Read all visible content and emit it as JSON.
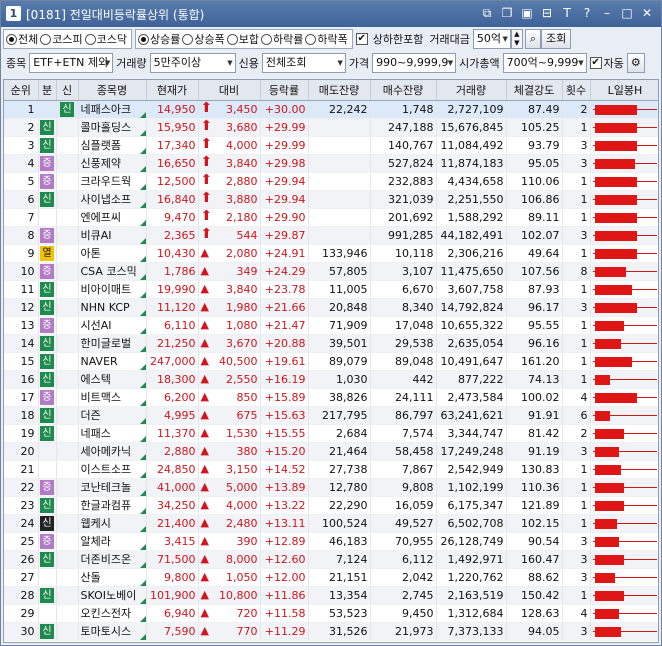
{
  "window": {
    "number": "1",
    "title": "[0181] 전일대비등락률상위 (통합)"
  },
  "filters": {
    "market_radios": [
      "전체",
      "코스피",
      "코스닥"
    ],
    "market_selected": 0,
    "sort_radios": [
      "상승률",
      "상승폭",
      "보합",
      "하락률",
      "하락폭"
    ],
    "sort_selected": 0,
    "include_limit_label": "상하한포함",
    "include_limit_checked": true,
    "volume_amount_label": "거래대금",
    "volume_amount_value": "50억",
    "search_button": "조회",
    "item_label": "종목",
    "item_value": "ETF+ETN 제외",
    "volume_label": "거래량",
    "volume_value": "5만주이상",
    "credit_label": "신용",
    "credit_value": "전체조회",
    "price_label": "가격",
    "price_value": "990~9,999,9",
    "mcap_label": "시가총액",
    "mcap_value": "700억~9,999",
    "auto_label": "자동",
    "auto_checked": true,
    "settings_icon": "gear-icon"
  },
  "columns": [
    "순위",
    "분",
    "신",
    "종목명",
    "현재가",
    "대비",
    "등락률",
    "매도잔량",
    "매수잔량",
    "거래량",
    "체결강도",
    "횟수",
    "L일봉H"
  ],
  "rows": [
    {
      "rank": "1",
      "badge": "",
      "badge_color": "",
      "new": "신",
      "name": "네패스아크",
      "price": "14,950",
      "arrow": "up",
      "diff": "3,450",
      "rate": "+30.00",
      "sell": "22,242",
      "buy": "1,748",
      "volume": "2,727,109",
      "strength": "87.49",
      "count": "2",
      "candle": 0.95
    },
    {
      "rank": "2",
      "badge": "신",
      "badge_color": "green",
      "new": "",
      "name": "콜마홀딩스",
      "price": "15,950",
      "arrow": "up",
      "diff": "3,680",
      "rate": "+29.99",
      "sell": "",
      "buy": "247,188",
      "volume": "15,676,845",
      "strength": "105.25",
      "count": "1",
      "candle": 0.95
    },
    {
      "rank": "3",
      "badge": "신",
      "badge_color": "green",
      "new": "",
      "name": "심플랫폼",
      "price": "17,340",
      "arrow": "up",
      "diff": "4,000",
      "rate": "+29.99",
      "sell": "",
      "buy": "140,767",
      "volume": "11,084,492",
      "strength": "93.79",
      "count": "3",
      "candle": 0.95
    },
    {
      "rank": "4",
      "badge": "증",
      "badge_color": "purple",
      "new": "",
      "name": "신풍제약",
      "price": "16,650",
      "arrow": "up",
      "diff": "3,840",
      "rate": "+29.98",
      "sell": "",
      "buy": "527,824",
      "volume": "11,874,183",
      "strength": "95.05",
      "count": "3",
      "candle": 0.9
    },
    {
      "rank": "5",
      "badge": "증",
      "badge_color": "purple",
      "new": "",
      "name": "크라우드웍",
      "price": "12,500",
      "arrow": "up",
      "diff": "2,880",
      "rate": "+29.94",
      "sell": "",
      "buy": "232,883",
      "volume": "4,434,658",
      "strength": "110.06",
      "count": "1",
      "candle": 0.95
    },
    {
      "rank": "6",
      "badge": "신",
      "badge_color": "green",
      "new": "",
      "name": "사이냅소프",
      "price": "16,840",
      "arrow": "up",
      "diff": "3,880",
      "rate": "+29.94",
      "sell": "",
      "buy": "321,039",
      "volume": "2,251,550",
      "strength": "106.86",
      "count": "1",
      "candle": 0.95
    },
    {
      "rank": "7",
      "badge": "",
      "badge_color": "",
      "new": "",
      "name": "엔에프씨",
      "price": "9,470",
      "arrow": "up",
      "diff": "2,180",
      "rate": "+29.90",
      "sell": "",
      "buy": "201,692",
      "volume": "1,588,292",
      "strength": "89.11",
      "count": "1",
      "candle": 0.95
    },
    {
      "rank": "8",
      "badge": "증",
      "badge_color": "purple",
      "new": "",
      "name": "비큐AI",
      "price": "2,365",
      "arrow": "up",
      "diff": "544",
      "rate": "+29.87",
      "sell": "",
      "buy": "991,285",
      "volume": "44,182,491",
      "strength": "102.07",
      "count": "3",
      "candle": 0.95
    },
    {
      "rank": "9",
      "badge": "열",
      "badge_color": "yellow",
      "new": "",
      "name": "아톤",
      "price": "10,430",
      "arrow": "tri",
      "diff": "2,080",
      "rate": "+24.91",
      "sell": "133,946",
      "buy": "10,118",
      "volume": "2,306,216",
      "strength": "49.64",
      "count": "1",
      "candle": 0.95
    },
    {
      "rank": "10",
      "badge": "증",
      "badge_color": "purple",
      "new": "",
      "name": "CSA 코스믹",
      "price": "1,786",
      "arrow": "tri",
      "diff": "349",
      "rate": "+24.29",
      "sell": "57,805",
      "buy": "3,107",
      "volume": "11,475,650",
      "strength": "107.56",
      "count": "8",
      "candle": 0.7
    },
    {
      "rank": "11",
      "badge": "신",
      "badge_color": "green",
      "new": "",
      "name": "비아이매트",
      "price": "19,990",
      "arrow": "tri",
      "diff": "3,840",
      "rate": "+23.78",
      "sell": "11,005",
      "buy": "6,670",
      "volume": "3,607,758",
      "strength": "87.93",
      "count": "1",
      "candle": 0.85
    },
    {
      "rank": "12",
      "badge": "신",
      "badge_color": "green",
      "new": "",
      "name": "NHN KCP",
      "price": "11,120",
      "arrow": "tri",
      "diff": "1,980",
      "rate": "+21.66",
      "sell": "20,848",
      "buy": "8,340",
      "volume": "14,792,824",
      "strength": "96.17",
      "count": "3",
      "candle": 0.95
    },
    {
      "rank": "13",
      "badge": "증",
      "badge_color": "purple",
      "new": "",
      "name": "시선AI",
      "price": "6,110",
      "arrow": "tri",
      "diff": "1,080",
      "rate": "+21.47",
      "sell": "71,909",
      "buy": "17,048",
      "volume": "10,655,322",
      "strength": "95.55",
      "count": "1",
      "candle": 0.65
    },
    {
      "rank": "14",
      "badge": "신",
      "badge_color": "green",
      "new": "",
      "name": "한미글로벌",
      "price": "21,250",
      "arrow": "tri",
      "diff": "3,670",
      "rate": "+20.88",
      "sell": "39,501",
      "buy": "29,538",
      "volume": "2,635,054",
      "strength": "96.16",
      "count": "1",
      "candle": 0.6
    },
    {
      "rank": "15",
      "badge": "신",
      "badge_color": "green",
      "new": "",
      "name": "NAVER",
      "price": "247,000",
      "arrow": "tri",
      "diff": "40,500",
      "rate": "+19.61",
      "sell": "89,079",
      "buy": "89,048",
      "volume": "10,491,647",
      "strength": "161.20",
      "count": "1",
      "candle": 0.85
    },
    {
      "rank": "16",
      "badge": "신",
      "badge_color": "green",
      "new": "",
      "name": "에스텍",
      "price": "18,300",
      "arrow": "tri",
      "diff": "2,550",
      "rate": "+16.19",
      "sell": "1,030",
      "buy": "442",
      "volume": "877,222",
      "strength": "74.13",
      "count": "1",
      "candle": 0.35
    },
    {
      "rank": "17",
      "badge": "증",
      "badge_color": "purple",
      "new": "",
      "name": "비트맥스",
      "price": "6,200",
      "arrow": "tri",
      "diff": "850",
      "rate": "+15.89",
      "sell": "38,826",
      "buy": "24,111",
      "volume": "2,473,584",
      "strength": "100.02",
      "count": "4",
      "candle": 0.95
    },
    {
      "rank": "18",
      "badge": "신",
      "badge_color": "green",
      "new": "",
      "name": "더즌",
      "price": "4,995",
      "arrow": "tri",
      "diff": "675",
      "rate": "+15.63",
      "sell": "217,795",
      "buy": "86,797",
      "volume": "63,241,621",
      "strength": "91.91",
      "count": "6",
      "candle": 0.35
    },
    {
      "rank": "19",
      "badge": "신",
      "badge_color": "green",
      "new": "",
      "name": "네패스",
      "price": "11,370",
      "arrow": "tri",
      "diff": "1,530",
      "rate": "+15.55",
      "sell": "2,684",
      "buy": "7,574",
      "volume": "3,344,747",
      "strength": "81.42",
      "count": "2",
      "candle": 0.65
    },
    {
      "rank": "20",
      "badge": "",
      "badge_color": "",
      "new": "",
      "name": "세아메카닉",
      "price": "2,880",
      "arrow": "tri",
      "diff": "380",
      "rate": "+15.20",
      "sell": "21,464",
      "buy": "58,458",
      "volume": "17,249,248",
      "strength": "91.19",
      "count": "3",
      "candle": 0.55
    },
    {
      "rank": "21",
      "badge": "",
      "badge_color": "",
      "new": "",
      "name": "이스트소프",
      "price": "24,850",
      "arrow": "tri",
      "diff": "3,150",
      "rate": "+14.52",
      "sell": "27,738",
      "buy": "7,867",
      "volume": "2,542,949",
      "strength": "130.83",
      "count": "1",
      "candle": 0.6
    },
    {
      "rank": "22",
      "badge": "증",
      "badge_color": "purple",
      "new": "",
      "name": "코난테크놀",
      "price": "41,000",
      "arrow": "tri",
      "diff": "5,000",
      "rate": "+13.89",
      "sell": "12,780",
      "buy": "9,808",
      "volume": "1,102,199",
      "strength": "110.36",
      "count": "1",
      "candle": 0.65
    },
    {
      "rank": "23",
      "badge": "신",
      "badge_color": "green",
      "new": "",
      "name": "한글과컴퓨",
      "price": "34,250",
      "arrow": "tri",
      "diff": "4,000",
      "rate": "+13.22",
      "sell": "22,290",
      "buy": "16,059",
      "volume": "6,175,347",
      "strength": "121.89",
      "count": "1",
      "candle": 0.65
    },
    {
      "rank": "24",
      "badge": "신",
      "badge_color": "black",
      "new": "",
      "name": "웹케시",
      "price": "21,400",
      "arrow": "tri",
      "diff": "2,480",
      "rate": "+13.11",
      "sell": "100,524",
      "buy": "49,527",
      "volume": "6,502,708",
      "strength": "102.15",
      "count": "1",
      "candle": 0.5
    },
    {
      "rank": "25",
      "badge": "증",
      "badge_color": "purple",
      "new": "",
      "name": "알체라",
      "price": "3,415",
      "arrow": "tri",
      "diff": "390",
      "rate": "+12.89",
      "sell": "46,183",
      "buy": "70,955",
      "volume": "26,128,749",
      "strength": "90.54",
      "count": "3",
      "candle": 0.55
    },
    {
      "rank": "26",
      "badge": "신",
      "badge_color": "green",
      "new": "",
      "name": "더존비즈온",
      "price": "71,500",
      "arrow": "tri",
      "diff": "8,000",
      "rate": "+12.60",
      "sell": "7,124",
      "buy": "6,112",
      "volume": "1,492,971",
      "strength": "160.47",
      "count": "3",
      "candle": 0.65
    },
    {
      "rank": "27",
      "badge": "",
      "badge_color": "",
      "new": "",
      "name": "산돌",
      "price": "9,800",
      "arrow": "tri",
      "diff": "1,050",
      "rate": "+12.00",
      "sell": "21,151",
      "buy": "2,042",
      "volume": "1,220,762",
      "strength": "88.62",
      "count": "3",
      "candle": 0.45
    },
    {
      "rank": "28",
      "badge": "신",
      "badge_color": "green",
      "new": "",
      "name": "SKOI노베이",
      "price": "101,900",
      "arrow": "tri",
      "diff": "10,800",
      "rate": "+11.86",
      "sell": "13,354",
      "buy": "2,745",
      "volume": "2,163,519",
      "strength": "150.42",
      "count": "1",
      "candle": 0.65
    },
    {
      "rank": "29",
      "badge": "",
      "badge_color": "",
      "new": "",
      "name": "오킨스전자",
      "price": "6,940",
      "arrow": "tri",
      "diff": "720",
      "rate": "+11.58",
      "sell": "53,523",
      "buy": "9,450",
      "volume": "1,312,684",
      "strength": "128.63",
      "count": "4",
      "candle": 0.55
    },
    {
      "rank": "30",
      "badge": "신",
      "badge_color": "green",
      "new": "",
      "name": "토마토시스",
      "price": "7,590",
      "arrow": "tri",
      "diff": "770",
      "rate": "+11.29",
      "sell": "31,526",
      "buy": "21,973",
      "volume": "7,373,133",
      "strength": "94.05",
      "count": "3",
      "candle": 0.6
    }
  ],
  "colors": {
    "up": "#d2141c",
    "badge_green": "#1f8a4d",
    "badge_purple": "#b27bc8",
    "badge_yellow": "#f2c400",
    "badge_black": "#222222",
    "selected_row": "#dbe9f8"
  }
}
